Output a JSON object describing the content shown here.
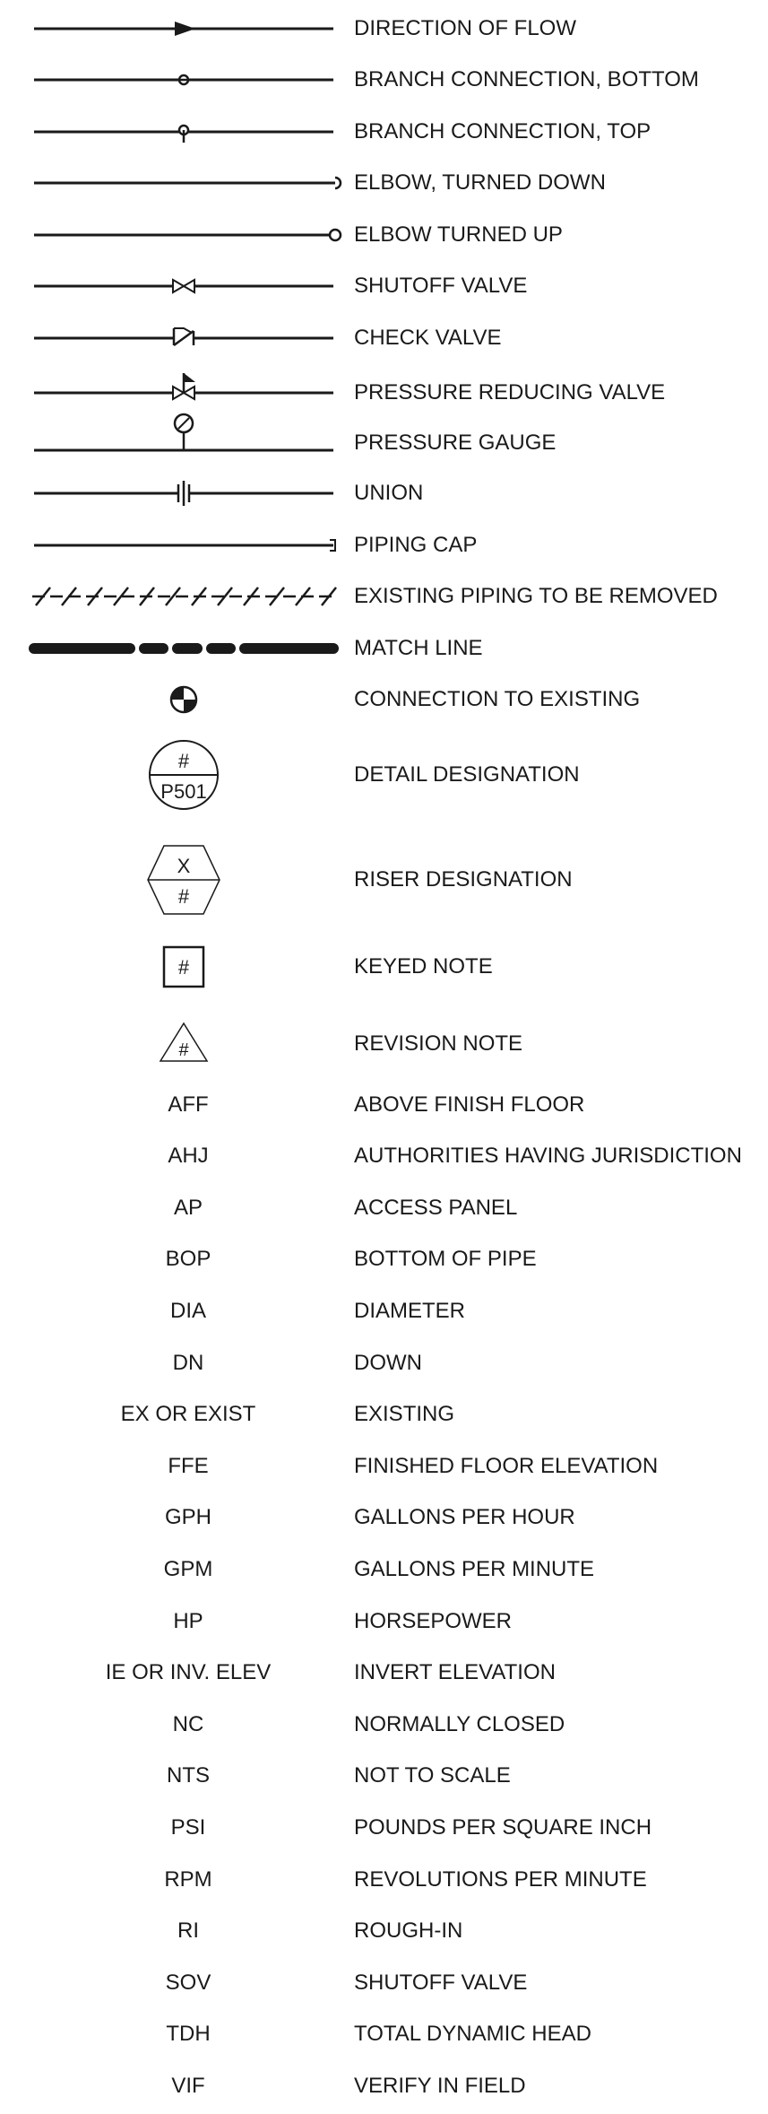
{
  "symbols": [
    {
      "icon": "direction-of-flow-icon",
      "label": "DIRECTION OF FLOW"
    },
    {
      "icon": "branch-connection-bottom-icon",
      "label": "BRANCH CONNECTION, BOTTOM"
    },
    {
      "icon": "branch-connection-top-icon",
      "label": "BRANCH CONNECTION, TOP"
    },
    {
      "icon": "elbow-turned-down-icon",
      "label": "ELBOW, TURNED DOWN"
    },
    {
      "icon": "elbow-turned-up-icon",
      "label": "ELBOW TURNED UP"
    },
    {
      "icon": "shutoff-valve-icon",
      "label": "SHUTOFF VALVE"
    },
    {
      "icon": "check-valve-icon",
      "label": "CHECK VALVE"
    },
    {
      "icon": "pressure-reducing-valve-icon",
      "label": "PRESSURE REDUCING VALVE"
    },
    {
      "icon": "pressure-gauge-icon",
      "label": "PRESSURE GAUGE"
    },
    {
      "icon": "union-icon",
      "label": "UNION"
    },
    {
      "icon": "piping-cap-icon",
      "label": "PIPING CAP"
    },
    {
      "icon": "existing-piping-removed-icon",
      "label": "EXISTING PIPING TO BE REMOVED"
    },
    {
      "icon": "match-line-icon",
      "label": "MATCH LINE"
    },
    {
      "icon": "connection-to-existing-icon",
      "label": "CONNECTION TO EXISTING"
    },
    {
      "icon": "detail-designation-icon",
      "label": "DETAIL DESIGNATION",
      "top_text": "#",
      "bottom_text": "P501"
    },
    {
      "icon": "riser-designation-icon",
      "label": "RISER DESIGNATION",
      "top_text": "X",
      "bottom_text": "#"
    },
    {
      "icon": "keyed-note-icon",
      "label": "KEYED NOTE",
      "text": "#"
    },
    {
      "icon": "revision-note-icon",
      "label": "REVISION NOTE",
      "text": "#"
    }
  ],
  "abbreviations": [
    {
      "abbr": "AFF",
      "meaning": "ABOVE FINISH FLOOR"
    },
    {
      "abbr": "AHJ",
      "meaning": "AUTHORITIES HAVING JURISDICTION"
    },
    {
      "abbr": "AP",
      "meaning": "ACCESS PANEL"
    },
    {
      "abbr": "BOP",
      "meaning": "BOTTOM OF PIPE"
    },
    {
      "abbr": "DIA",
      "meaning": "DIAMETER"
    },
    {
      "abbr": "DN",
      "meaning": "DOWN"
    },
    {
      "abbr": "EX OR EXIST",
      "meaning": "EXISTING"
    },
    {
      "abbr": "FFE",
      "meaning": "FINISHED FLOOR ELEVATION"
    },
    {
      "abbr": "GPH",
      "meaning": "GALLONS PER HOUR"
    },
    {
      "abbr": "GPM",
      "meaning": "GALLONS PER MINUTE"
    },
    {
      "abbr": "HP",
      "meaning": "HORSEPOWER"
    },
    {
      "abbr": "IE OR INV. ELEV",
      "meaning": "INVERT ELEVATION"
    },
    {
      "abbr": "NC",
      "meaning": "NORMALLY CLOSED"
    },
    {
      "abbr": "NTS",
      "meaning": "NOT TO SCALE"
    },
    {
      "abbr": "PSI",
      "meaning": "POUNDS PER SQUARE INCH"
    },
    {
      "abbr": "RPM",
      "meaning": "REVOLUTIONS PER MINUTE"
    },
    {
      "abbr": "RI",
      "meaning": "ROUGH-IN"
    },
    {
      "abbr": "SOV",
      "meaning": "SHUTOFF VALVE"
    },
    {
      "abbr": "TDH",
      "meaning": "TOTAL DYNAMIC HEAD"
    },
    {
      "abbr": "VIF",
      "meaning": "VERIFY IN FIELD"
    }
  ]
}
